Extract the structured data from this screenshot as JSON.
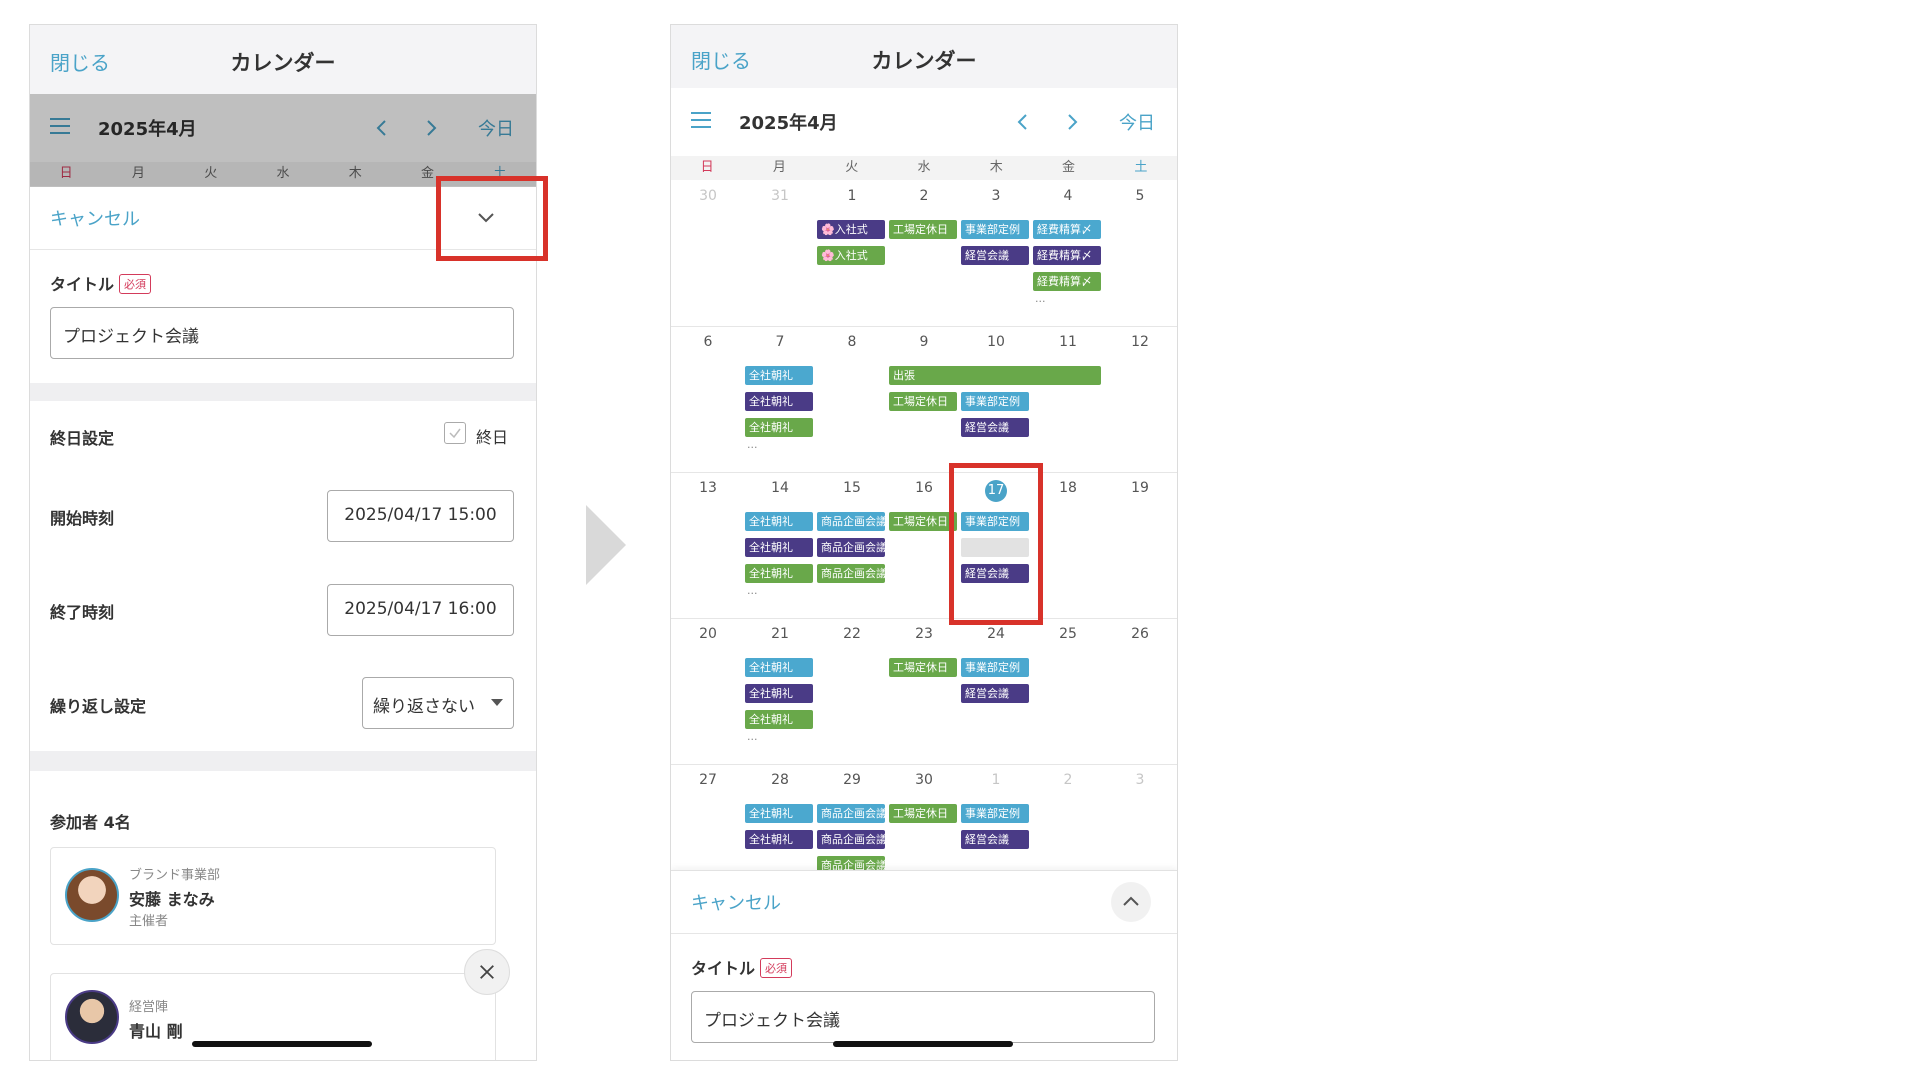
{
  "nav": {
    "close": "閉じる",
    "title": "カレンダー"
  },
  "toolbar": {
    "month": "2025年4月",
    "today": "今日"
  },
  "weekdays": [
    "日",
    "月",
    "火",
    "水",
    "木",
    "金",
    "土"
  ],
  "form": {
    "cancel": "キャンセル",
    "title_label": "タイトル",
    "required": "必須",
    "title_value": "プロジェクト会議",
    "allday_label": "終日設定",
    "allday_option": "終日",
    "start_label": "開始時刻",
    "start_value": "2025/04/17 15:00",
    "end_label": "終了時刻",
    "end_value": "2025/04/17 16:00",
    "repeat_label": "繰り返し設定",
    "repeat_value": "繰り返さない",
    "participants_label": "参加者 4名",
    "participants": [
      {
        "dept": "ブランド事業部",
        "name": "安藤 まなみ",
        "role": "主催者"
      },
      {
        "dept": "経営陣",
        "name": "青山 剛",
        "role": ""
      }
    ]
  },
  "calendar": {
    "weeks": [
      {
        "days": [
          "30",
          "31",
          "1",
          "2",
          "3",
          "4",
          "5"
        ],
        "muted": [
          0,
          1
        ],
        "events": [
          {
            "col": 2,
            "row": 0,
            "span": 1,
            "color": "purple",
            "label": "🌸入社式"
          },
          {
            "col": 2,
            "row": 1,
            "span": 1,
            "color": "green",
            "label": "🌸入社式"
          },
          {
            "col": 3,
            "row": 0,
            "span": 1,
            "color": "green",
            "label": "工場定休日"
          },
          {
            "col": 4,
            "row": 0,
            "span": 1,
            "color": "blue",
            "label": "事業部定例"
          },
          {
            "col": 4,
            "row": 1,
            "span": 1,
            "color": "purple",
            "label": "経営会議"
          },
          {
            "col": 5,
            "row": 0,
            "span": 1,
            "color": "blue",
            "label": "経費精算〆"
          },
          {
            "col": 5,
            "row": 1,
            "span": 1,
            "color": "purple",
            "label": "経費精算〆"
          },
          {
            "col": 5,
            "row": 2,
            "span": 1,
            "color": "green",
            "label": "経費精算〆"
          }
        ],
        "more": [
          5
        ]
      },
      {
        "days": [
          "6",
          "7",
          "8",
          "9",
          "10",
          "11",
          "12"
        ],
        "muted": [],
        "events": [
          {
            "col": 1,
            "row": 0,
            "span": 1,
            "color": "blue",
            "label": "全社朝礼"
          },
          {
            "col": 1,
            "row": 1,
            "span": 1,
            "color": "purple",
            "label": "全社朝礼"
          },
          {
            "col": 1,
            "row": 2,
            "span": 1,
            "color": "green",
            "label": "全社朝礼"
          },
          {
            "col": 3,
            "row": 0,
            "span": 3,
            "color": "green",
            "label": "出張"
          },
          {
            "col": 3,
            "row": 1,
            "span": 1,
            "color": "green",
            "label": "工場定休日"
          },
          {
            "col": 4,
            "row": 1,
            "span": 1,
            "color": "blue",
            "label": "事業部定例"
          },
          {
            "col": 4,
            "row": 2,
            "span": 1,
            "color": "purple",
            "label": "経営会議"
          }
        ],
        "more": [
          1
        ]
      },
      {
        "days": [
          "13",
          "14",
          "15",
          "16",
          "17",
          "18",
          "19"
        ],
        "muted": [],
        "today_col": 4,
        "events": [
          {
            "col": 1,
            "row": 0,
            "span": 1,
            "color": "blue",
            "label": "全社朝礼"
          },
          {
            "col": 1,
            "row": 1,
            "span": 1,
            "color": "purple",
            "label": "全社朝礼"
          },
          {
            "col": 1,
            "row": 2,
            "span": 1,
            "color": "green",
            "label": "全社朝礼"
          },
          {
            "col": 2,
            "row": 0,
            "span": 1,
            "color": "blue",
            "label": "商品企画会議"
          },
          {
            "col": 2,
            "row": 1,
            "span": 1,
            "color": "purple",
            "label": "商品企画会議"
          },
          {
            "col": 2,
            "row": 2,
            "span": 1,
            "color": "green",
            "label": "商品企画会議"
          },
          {
            "col": 3,
            "row": 0,
            "span": 1,
            "color": "green",
            "label": "工場定休日"
          },
          {
            "col": 4,
            "row": 0,
            "span": 1,
            "color": "blue",
            "label": "事業部定例"
          },
          {
            "col": 4,
            "row": 1,
            "span": 1,
            "color": "grey",
            "label": ""
          },
          {
            "col": 4,
            "row": 2,
            "span": 1,
            "color": "purple",
            "label": "経営会議"
          }
        ],
        "more": [
          1
        ]
      },
      {
        "days": [
          "20",
          "21",
          "22",
          "23",
          "24",
          "25",
          "26"
        ],
        "muted": [],
        "events": [
          {
            "col": 1,
            "row": 0,
            "span": 1,
            "color": "blue",
            "label": "全社朝礼"
          },
          {
            "col": 1,
            "row": 1,
            "span": 1,
            "color": "purple",
            "label": "全社朝礼"
          },
          {
            "col": 1,
            "row": 2,
            "span": 1,
            "color": "green",
            "label": "全社朝礼"
          },
          {
            "col": 3,
            "row": 0,
            "span": 1,
            "color": "green",
            "label": "工場定休日"
          },
          {
            "col": 4,
            "row": 0,
            "span": 1,
            "color": "blue",
            "label": "事業部定例"
          },
          {
            "col": 4,
            "row": 1,
            "span": 1,
            "color": "purple",
            "label": "経営会議"
          }
        ],
        "more": [
          1
        ]
      },
      {
        "days": [
          "27",
          "28",
          "29",
          "30",
          "1",
          "2",
          "3"
        ],
        "muted": [
          4,
          5,
          6
        ],
        "events": [
          {
            "col": 1,
            "row": 0,
            "span": 1,
            "color": "blue",
            "label": "全社朝礼"
          },
          {
            "col": 1,
            "row": 1,
            "span": 1,
            "color": "purple",
            "label": "全社朝礼"
          },
          {
            "col": 2,
            "row": 0,
            "span": 1,
            "color": "blue",
            "label": "商品企画会議"
          },
          {
            "col": 2,
            "row": 1,
            "span": 1,
            "color": "purple",
            "label": "商品企画会議"
          },
          {
            "col": 2,
            "row": 2,
            "span": 1,
            "color": "green",
            "label": "商品企画会議"
          },
          {
            "col": 3,
            "row": 0,
            "span": 1,
            "color": "green",
            "label": "工場定休日"
          },
          {
            "col": 4,
            "row": 0,
            "span": 1,
            "color": "blue",
            "label": "事業部定例"
          },
          {
            "col": 4,
            "row": 1,
            "span": 1,
            "color": "purple",
            "label": "経営会議"
          }
        ],
        "more": []
      }
    ]
  }
}
